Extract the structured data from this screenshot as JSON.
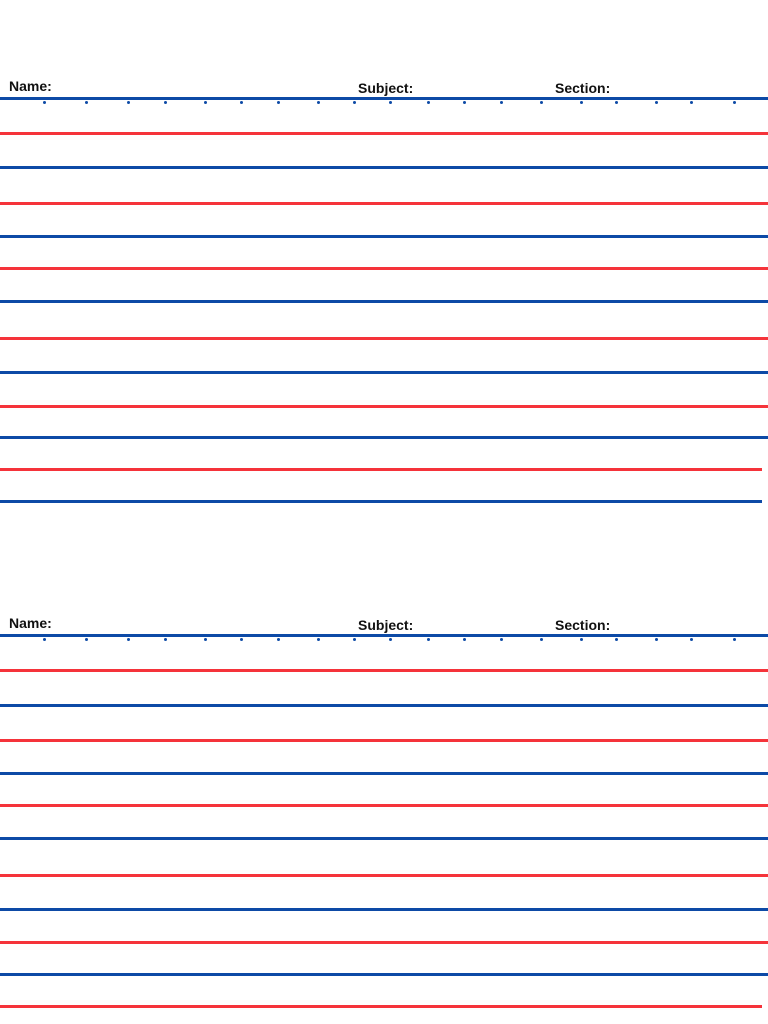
{
  "worksheets": [
    {
      "name_label": "Name:",
      "subject_label": "Subject:",
      "section_label": "Section:"
    },
    {
      "name_label": "Name:",
      "subject_label": "Subject:",
      "section_label": "Section:"
    }
  ],
  "colors": {
    "guide_blue": "#0d4aa6",
    "guide_red": "#f5333a"
  }
}
